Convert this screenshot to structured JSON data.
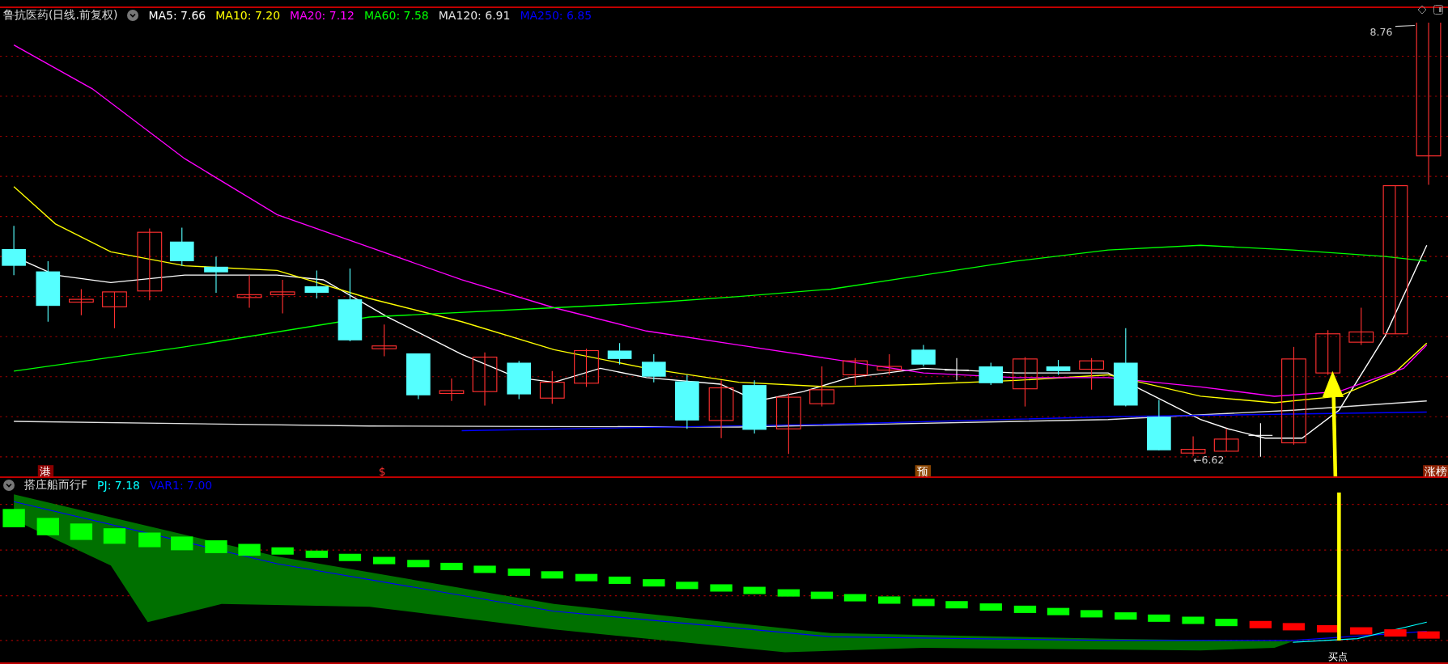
{
  "main_panel": {
    "title": "鲁抗医药(日线.前复权)",
    "indicators": [
      {
        "label": "MA5: 7.66",
        "color": "#ffffff"
      },
      {
        "label": "MA10: 7.20",
        "color": "#ffff00"
      },
      {
        "label": "MA20: 7.12",
        "color": "#ff00ff"
      },
      {
        "label": "MA60: 7.58",
        "color": "#00ff00"
      },
      {
        "label": "MA120: 6.91",
        "color": "#e0e0e0"
      },
      {
        "label": "MA250: 6.85",
        "color": "#0000ff"
      }
    ],
    "high_label": "8.76",
    "low_label": "←6.62",
    "event_tags": [
      {
        "text": "港",
        "kind": "badge",
        "color": "#8b0000"
      },
      {
        "text": "$",
        "kind": "glyph",
        "color": "#ff3030"
      },
      {
        "text": "预",
        "kind": "badge",
        "color": "#8b4500"
      },
      {
        "text": "涨榜",
        "kind": "badge",
        "color": "#8b2000"
      }
    ]
  },
  "sub_panel": {
    "title": "搭庄船而行F",
    "indicators": [
      {
        "label": "PJ: 7.18",
        "color": "#00ffff"
      },
      {
        "label": "VAR1: 7.00",
        "color": "#0000ff"
      }
    ],
    "signal_label": "买点"
  }
}
